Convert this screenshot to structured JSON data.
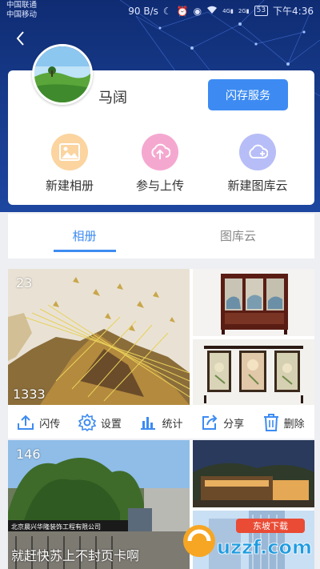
{
  "status_bar": {
    "carrier_1": "中国联通",
    "carrier_2": "中国移动",
    "speed": "90 B/s",
    "net_1": "4G",
    "net_2": "2G",
    "battery": "53",
    "time": "下午4:36"
  },
  "profile": {
    "name": "马阔",
    "flash_button": "闪存服务"
  },
  "actions": [
    {
      "label": "新建相册",
      "icon": "image-icon",
      "color": "#fbd4a0"
    },
    {
      "label": "参与上传",
      "icon": "upload-icon",
      "color": "#f5a8cf"
    },
    {
      "label": "新建图库云",
      "icon": "cloud-icon",
      "color": "#b7bdf7"
    }
  ],
  "tabs": [
    {
      "label": "相册",
      "active": true
    },
    {
      "label": "图库云",
      "active": false
    }
  ],
  "albums": [
    {
      "count": "23",
      "photo_count": "1333"
    },
    {
      "count": "146",
      "caption": "就赶快苏上不封页卡啊"
    }
  ],
  "toolbar": {
    "flash": "闪传",
    "settings": "设置",
    "stats": "统计",
    "share": "分享",
    "delete": "删除"
  },
  "photo_text": {
    "building_sign": "北京晨兴华隆装饰工程有限公司"
  },
  "watermark": {
    "brand": "uzzf.com",
    "sub": "东坡下载"
  },
  "colors": {
    "accent": "#3d8bf2",
    "header": "#173a8a"
  }
}
